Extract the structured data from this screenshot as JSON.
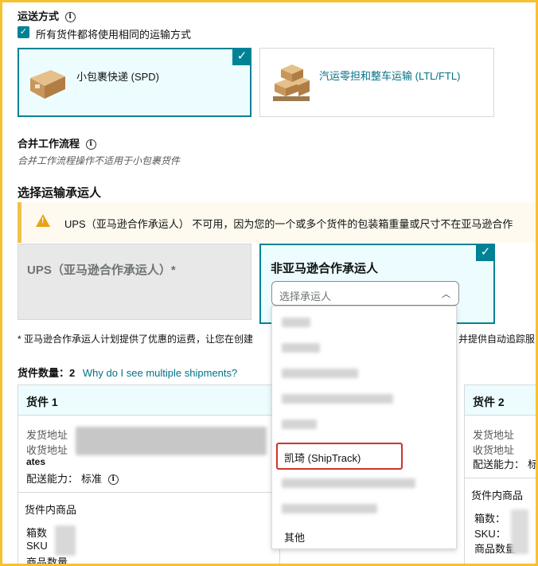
{
  "shipping_method": {
    "title": "运送方式",
    "same_method_label": "所有货件都将使用相同的运输方式",
    "options": [
      {
        "label": "小包裹快递 (SPD)",
        "selected": true
      },
      {
        "label": "汽运零担和整车运输 (LTL/FTL)",
        "selected": false
      }
    ]
  },
  "workflow": {
    "title": "合并工作流程",
    "note": "合并工作流程操作不适用于小包裹货件"
  },
  "carrier": {
    "title": "选择运输承运人",
    "alert": "UPS（亚马逊合作承运人） 不可用，因为您的一个或多个货件的包装箱重量或尺寸不在亚马逊合作",
    "ups_label": "UPS（亚马逊合作承运人）*",
    "non_partner_label": "非亚马逊合作承运人",
    "select_placeholder": "选择承运人",
    "dropdown_highlighted": "凯琦 (ShipTrack)",
    "dropdown_other": "其他",
    "footnote_left": "* 亚马逊合作承运人计划提供了优惠的运费，让您在创建",
    "footnote_right": "并提供自动追踪服"
  },
  "shipments": {
    "count_label": "货件数量：",
    "count": "2",
    "why_link": "Why do I see multiple shipments?",
    "items": [
      {
        "title": "货件 1",
        "from_label": "发货地址",
        "to_label": "收货地址",
        "to_fragment": "ates",
        "capability_label": "配送能力：",
        "capability_value": "标准",
        "contents_title": "货件内商品",
        "boxes_label": "箱数",
        "sku_label": "SKU",
        "qty_label": "商品数量"
      },
      {
        "title": "货件 2",
        "from_label": "发货地址",
        "to_label": "收货地址",
        "capability_label": "配送能力：",
        "capability_value": "标",
        "contents_title": "货件内商品",
        "boxes_label": "箱数：",
        "sku_label": "SKU：",
        "qty_label": "商品数量"
      }
    ]
  },
  "colors": {
    "accent": "#008296",
    "link": "#007185",
    "frame": "#f7c12e",
    "alert_bar": "#f0c14b",
    "highlight": "#d0342c"
  }
}
